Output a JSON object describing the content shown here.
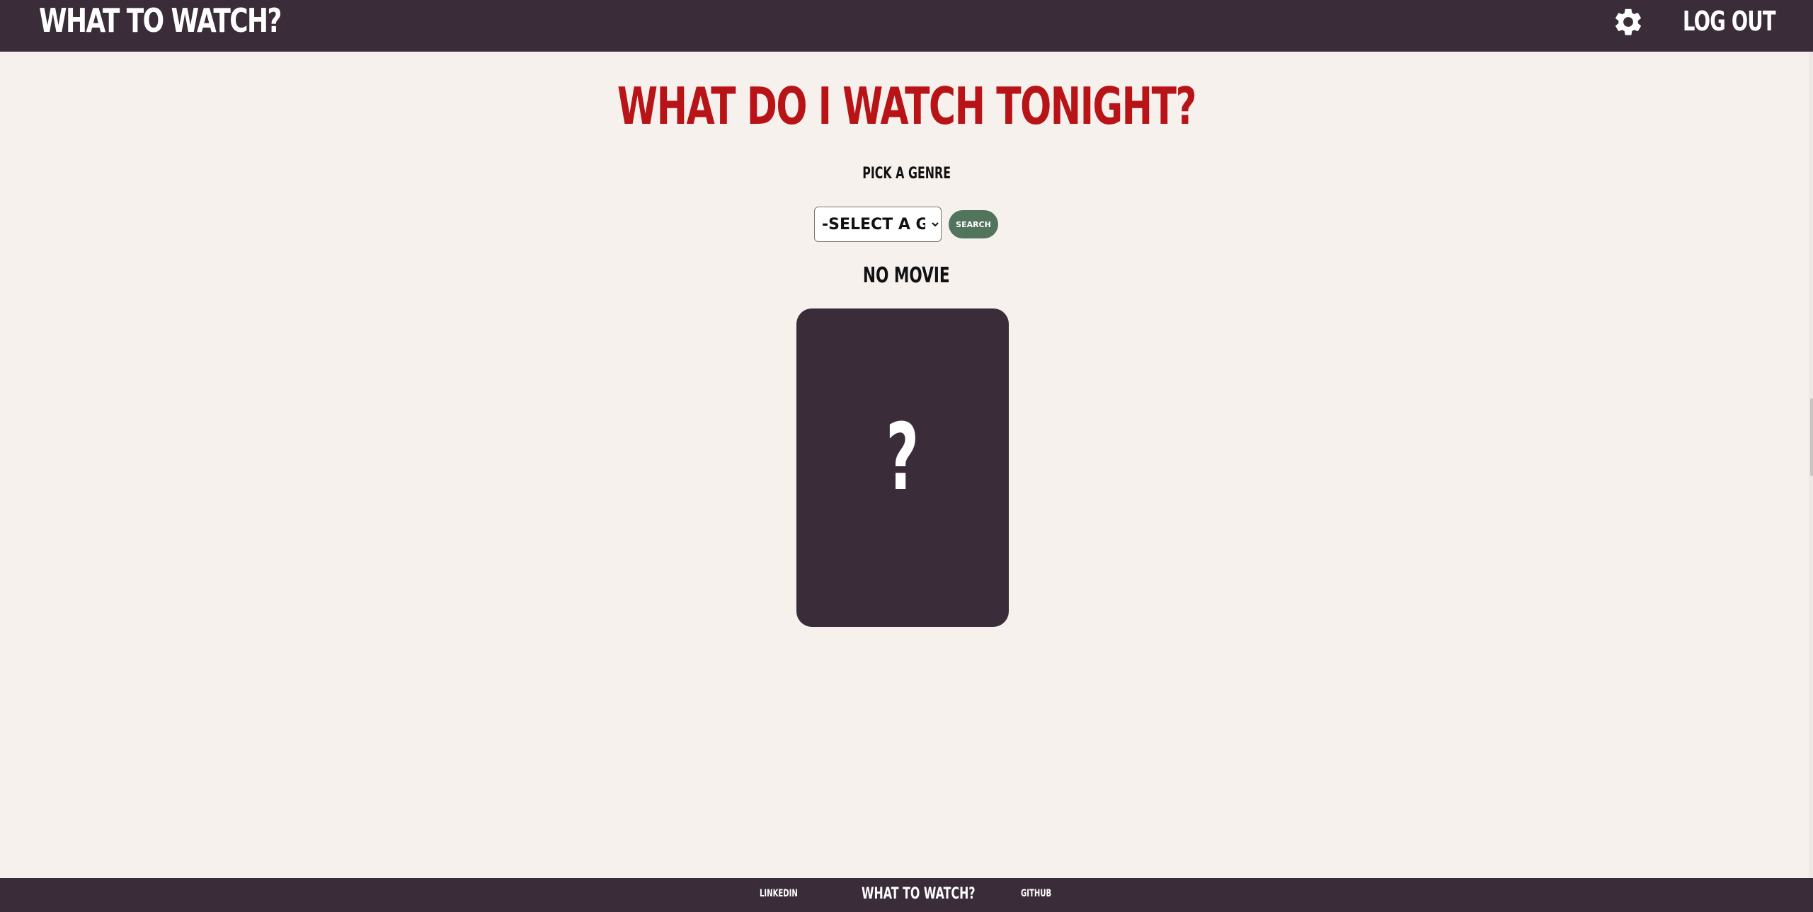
{
  "header": {
    "brand": "WHAT TO WATCH?",
    "settings_icon": "gear-icon",
    "logout_label": "LOG OUT"
  },
  "main": {
    "title": "WHAT DO I WATCH TONIGHT?",
    "pick_label": "PICK A GENRE",
    "genre_select": {
      "selected": "-SELECT A GENRE-"
    },
    "search_label": "SEARCH",
    "result_title": "NO MOVIE",
    "poster_placeholder": "?"
  },
  "footer": {
    "linkedin_label": "LINKEDIN",
    "brand": "WHAT TO WATCH?",
    "github_label": "GITHUB"
  },
  "colors": {
    "header_bg": "#3a2d39",
    "page_bg": "#f7f1ee",
    "title_red": "#b81418",
    "search_green": "#52735c"
  }
}
